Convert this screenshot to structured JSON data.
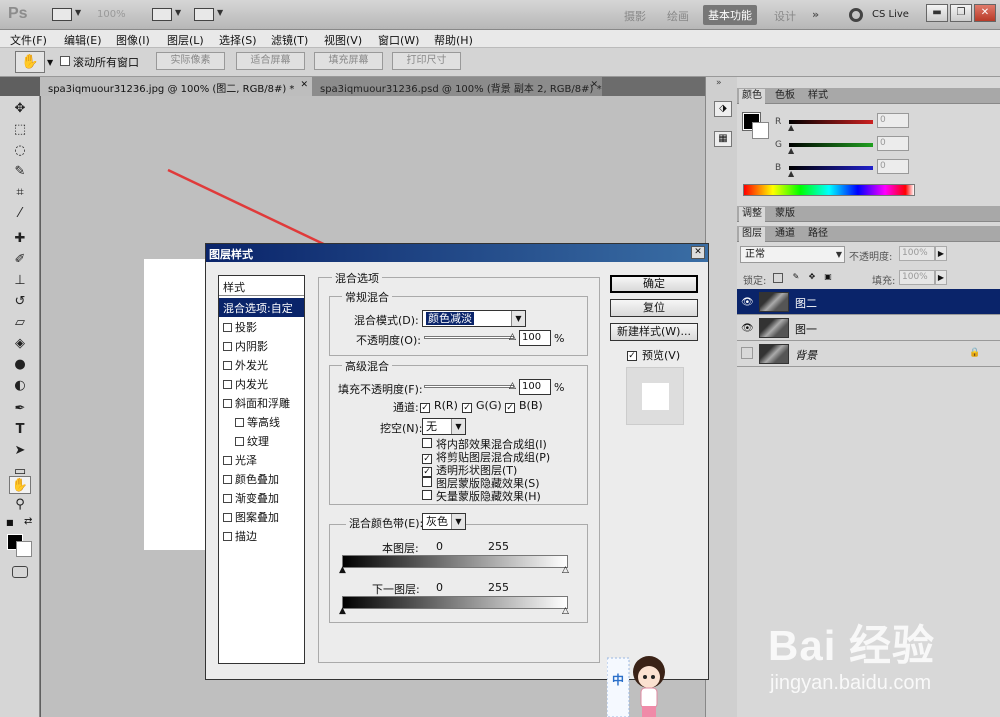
{
  "appbar": {
    "logo": "Ps",
    "zoom": "100%",
    "workspaces": [
      "摄影",
      "绘画",
      "基本功能",
      "设计"
    ],
    "active_workspace": "基本功能",
    "more": "»",
    "cslive": "CS Live"
  },
  "menubar": {
    "items": [
      "文件(F)",
      "编辑(E)",
      "图像(I)",
      "图层(L)",
      "选择(S)",
      "滤镜(T)",
      "视图(V)",
      "窗口(W)",
      "帮助(H)"
    ]
  },
  "options": {
    "scroll_all": "滚动所有窗口",
    "buttons": [
      "实际像素",
      "适合屏幕",
      "填充屏幕",
      "打印尺寸"
    ]
  },
  "doc_tabs": [
    "spa3iqmuour31236.jpg @ 100% (图二, RGB/8#) *",
    "spa3iqmuour31236.psd @ 100% (背景 副本 2, RGB/8#) *"
  ],
  "color_panel": {
    "tabs": [
      "颜色",
      "色板",
      "样式"
    ],
    "channels": [
      {
        "label": "R",
        "value": "0",
        "color": "#cc2020"
      },
      {
        "label": "G",
        "value": "0",
        "color": "#20a020"
      },
      {
        "label": "B",
        "value": "0",
        "color": "#2020cc"
      }
    ]
  },
  "adjust_panel": {
    "tabs": [
      "调整",
      "蒙版"
    ]
  },
  "layers_panel": {
    "tabs": [
      "图层",
      "通道",
      "路径"
    ],
    "blend_mode": "正常",
    "opacity_label": "不透明度:",
    "opacity": "100%",
    "lock_label": "锁定:",
    "fill_label": "填充:",
    "fill": "100%",
    "layers": [
      {
        "name": "图二",
        "selected": true,
        "visible": true
      },
      {
        "name": "图一",
        "selected": false,
        "visible": true
      },
      {
        "name": "背景",
        "selected": false,
        "visible": false,
        "locked": true
      }
    ]
  },
  "dialog": {
    "title": "图层样式",
    "styles_header": "样式",
    "styles": [
      {
        "label": "混合选项:自定",
        "selected": true
      },
      {
        "label": "投影"
      },
      {
        "label": "内阴影"
      },
      {
        "label": "外发光"
      },
      {
        "label": "内发光"
      },
      {
        "label": "斜面和浮雕"
      },
      {
        "label": "等高线",
        "indent": true
      },
      {
        "label": "纹理",
        "indent": true
      },
      {
        "label": "光泽"
      },
      {
        "label": "颜色叠加"
      },
      {
        "label": "渐变叠加"
      },
      {
        "label": "图案叠加"
      },
      {
        "label": "描边"
      }
    ],
    "blend_options_title": "混合选项",
    "general_title": "常规混合",
    "blend_mode_label": "混合模式(D):",
    "blend_mode": "颜色减淡",
    "opacity_label": "不透明度(O):",
    "opacity": "100",
    "percent": "%",
    "advanced_title": "高级混合",
    "fill_opacity_label": "填充不透明度(F):",
    "fill_opacity": "100",
    "channels_label": "通道:",
    "channels": [
      "R(R)",
      "G(G)",
      "B(B)"
    ],
    "knockout_label": "挖空(N):",
    "knockout": "无",
    "checkbox_options": [
      {
        "label": "将内部效果混合成组(I)",
        "checked": false
      },
      {
        "label": "将剪贴图层混合成组(P)",
        "checked": true
      },
      {
        "label": "透明形状图层(T)",
        "checked": true
      },
      {
        "label": "图层蒙版隐藏效果(S)",
        "checked": false
      },
      {
        "label": "矢量蒙版隐藏效果(H)",
        "checked": false
      }
    ],
    "blend_if_label": "混合颜色带(E):",
    "blend_if": "灰色",
    "this_layer_label": "本图层:",
    "under_layer_label": "下一图层:",
    "range_min": "0",
    "range_max": "255",
    "ok": "确定",
    "reset": "复位",
    "new_style": "新建样式(W)...",
    "preview_label": "预览(V)"
  },
  "watermark": {
    "text": "Bai 经验",
    "sub": "jingyan.baidu.com"
  },
  "sticker": {
    "text": "中"
  }
}
